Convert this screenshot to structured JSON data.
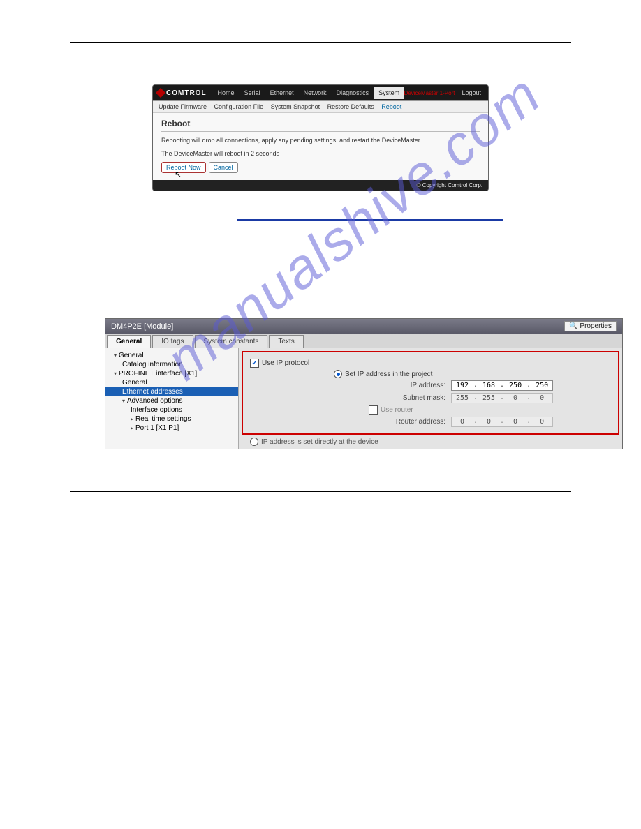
{
  "watermark": "manualshive.com",
  "reboot": {
    "brand": "COMTROL",
    "nav": [
      "Home",
      "Serial",
      "Ethernet",
      "Network",
      "Diagnostics",
      "System"
    ],
    "nav_active_index": 5,
    "status_text": "DeviceMaster 1-Port",
    "logout": "Logout",
    "subnav": [
      "Update Firmware",
      "Configuration File",
      "System Snapshot",
      "Restore Defaults",
      "Reboot"
    ],
    "subnav_active_index": 4,
    "title": "Reboot",
    "line1": "Rebooting will drop all connections, apply any pending settings, and restart the DeviceMaster.",
    "line2": "The DeviceMaster will reboot in 2 seconds",
    "btn_reboot": "Reboot Now",
    "btn_cancel": "Cancel",
    "copyright": "© Copyright Comtrol Corp."
  },
  "tia": {
    "window_title": "DM4P2E [Module]",
    "props_label": "Properties",
    "tabs": [
      "General",
      "IO tags",
      "System constants",
      "Texts"
    ],
    "tab_active_index": 0,
    "tree": {
      "general": "General",
      "catalog": "Catalog information",
      "profinet": "PROFINET interface [X1]",
      "general2": "General",
      "ethernet_addr": "Ethernet addresses",
      "advanced": "Advanced options",
      "iface_opts": "Interface options",
      "rt": "Real time settings",
      "port1": "Port 1 [X1 P1]"
    },
    "use_ip_label": "Use IP protocol",
    "set_ip_label": "Set IP address in the project",
    "ip_label": "IP address:",
    "ip_value": [
      "192",
      "168",
      "250",
      "250"
    ],
    "subnet_label": "Subnet mask:",
    "subnet_value": [
      "255",
      "255",
      "0",
      "0"
    ],
    "use_router_label": "Use router",
    "router_label": "Router address:",
    "router_value": [
      "0",
      "0",
      "0",
      "0"
    ],
    "direct_label": "IP address is set directly at the device"
  }
}
